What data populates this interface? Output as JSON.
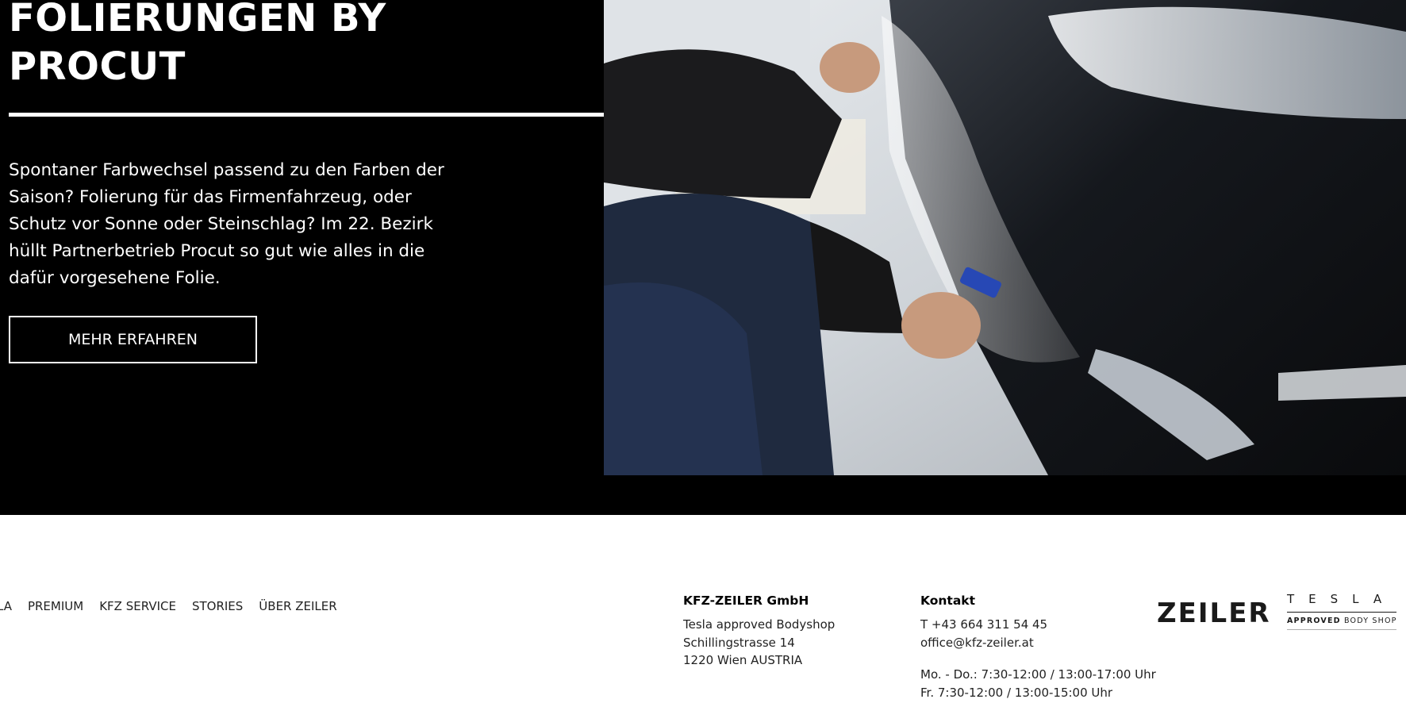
{
  "hero": {
    "title_line1": "FOLIERUNGEN BY",
    "title_line2": "PROCUT",
    "paragraph": "Spontaner Farbwechsel passend zu den Farben der Saison? Folierung für das Firmenfahrzeug, oder Schutz vor Sonne oder Steinschlag? Im 22. Bezirk hüllt Partnerbetrieb Procut so gut wie alles in die dafür vorgesehene Folie.",
    "button_label": "MEHR ERFAHREN",
    "image_description": "Technician applying protective film to black car bumper"
  },
  "footer": {
    "nav": [
      "LA",
      "PREMIUM",
      "KFZ SERVICE",
      "STORIES",
      "ÜBER ZEILER"
    ],
    "company": {
      "heading": "KFZ-ZEILER GmbH",
      "line1": "Tesla approved Bodyshop",
      "line2": "Schillingstrasse 14",
      "line3": "1220 Wien AUSTRIA"
    },
    "contact": {
      "heading": "Kontakt",
      "phone": "T +43 664 311 54 45",
      "email": "office@kfz-zeiler.at",
      "hours1": "Mo. - Do.: 7:30-12:00 / 13:00-17:00 Uhr",
      "hours2": "Fr. 7:30-12:00 / 13:00-15:00 Uhr"
    },
    "logo_zeiler": "ZEILER",
    "logo_tesla": "TESLA",
    "logo_tesla_sub_bold": "APPROVED",
    "logo_tesla_sub_rest": "BODY SHOP"
  },
  "colors": {
    "hero_bg": "#000000",
    "text_on_dark": "#ffffff",
    "footer_text": "#222222"
  }
}
